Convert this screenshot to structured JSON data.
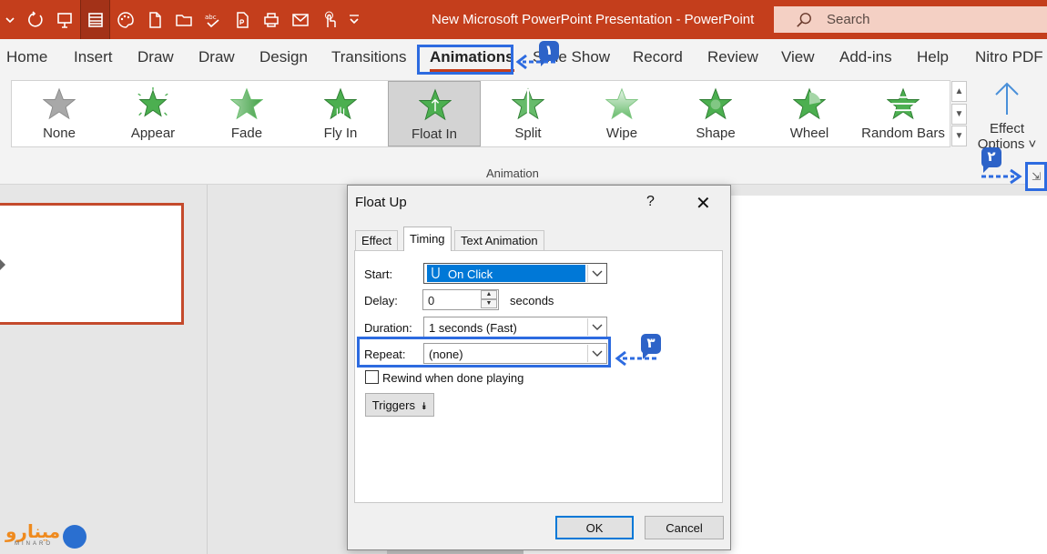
{
  "window": {
    "title": "New Microsoft PowerPoint Presentation - PowerPoint",
    "search_placeholder": "Search"
  },
  "quick_access": [
    {
      "icon": "undo-dropdown-icon"
    },
    {
      "icon": "redo-icon"
    },
    {
      "icon": "present-icon"
    },
    {
      "icon": "layout-icon",
      "selected": true
    },
    {
      "icon": "theme-palette-icon"
    },
    {
      "icon": "new-file-icon"
    },
    {
      "icon": "open-folder-icon"
    },
    {
      "icon": "spelling-icon"
    },
    {
      "icon": "export-pdf-icon"
    },
    {
      "icon": "print-preview-icon"
    },
    {
      "icon": "email-icon"
    },
    {
      "icon": "touch-mode-icon"
    },
    {
      "icon": "customize-dropdown-icon"
    }
  ],
  "ribbon_tabs": [
    {
      "label": "Home"
    },
    {
      "label": "Insert"
    },
    {
      "label": "Draw"
    },
    {
      "label": "Draw"
    },
    {
      "label": "Design"
    },
    {
      "label": "Transitions"
    },
    {
      "label": "Animations",
      "active": true
    },
    {
      "label": "Slide Show"
    },
    {
      "label": "Record"
    },
    {
      "label": "Review"
    },
    {
      "label": "View"
    },
    {
      "label": "Add-ins"
    },
    {
      "label": "Help"
    },
    {
      "label": "Nitro PDF"
    }
  ],
  "animation_gallery": {
    "items": [
      {
        "label": "None",
        "icon": "star-gray-icon"
      },
      {
        "label": "Appear",
        "icon": "star-burst-icon"
      },
      {
        "label": "Fade",
        "icon": "star-fade-icon"
      },
      {
        "label": "Fly In",
        "icon": "star-fly-in-icon"
      },
      {
        "label": "Float In",
        "icon": "star-float-in-icon",
        "selected": true
      },
      {
        "label": "Split",
        "icon": "star-split-icon"
      },
      {
        "label": "Wipe",
        "icon": "star-wipe-icon"
      },
      {
        "label": "Shape",
        "icon": "star-shape-icon"
      },
      {
        "label": "Wheel",
        "icon": "star-wheel-icon"
      },
      {
        "label": "Random Bars",
        "icon": "star-random-bars-icon"
      }
    ],
    "group_label": "Animation",
    "effect_options_line1": "Effect",
    "effect_options_line2": "Options ˅"
  },
  "dialog": {
    "title": "Float Up",
    "help": "?",
    "close": "✕",
    "tabs": [
      {
        "label": "Effect"
      },
      {
        "label": "Timing",
        "active": true
      },
      {
        "label": "Text Animation"
      }
    ],
    "start_label": "Start:",
    "start_value": "On Click",
    "delay_label": "Delay:",
    "delay_value": "0",
    "delay_unit": "seconds",
    "duration_label": "Duration:",
    "duration_value": "1 seconds (Fast)",
    "repeat_label": "Repeat:",
    "repeat_value": "(none)",
    "rewind_label": "Rewind when done playing",
    "rewind_checked": false,
    "triggers_label": "Triggers",
    "ok_label": "OK",
    "cancel_label": "Cancel"
  },
  "callouts": [
    {
      "badge": "۱"
    },
    {
      "badge": "۲"
    },
    {
      "badge": "۳"
    }
  ],
  "watermark": {
    "text": "مینارو",
    "subtext": "MINARO"
  },
  "colors": {
    "titlebar": "#c43e1c",
    "accent_blue": "#2d6be0",
    "star_green": "#4caf50",
    "selection_blue": "#0078d7"
  }
}
